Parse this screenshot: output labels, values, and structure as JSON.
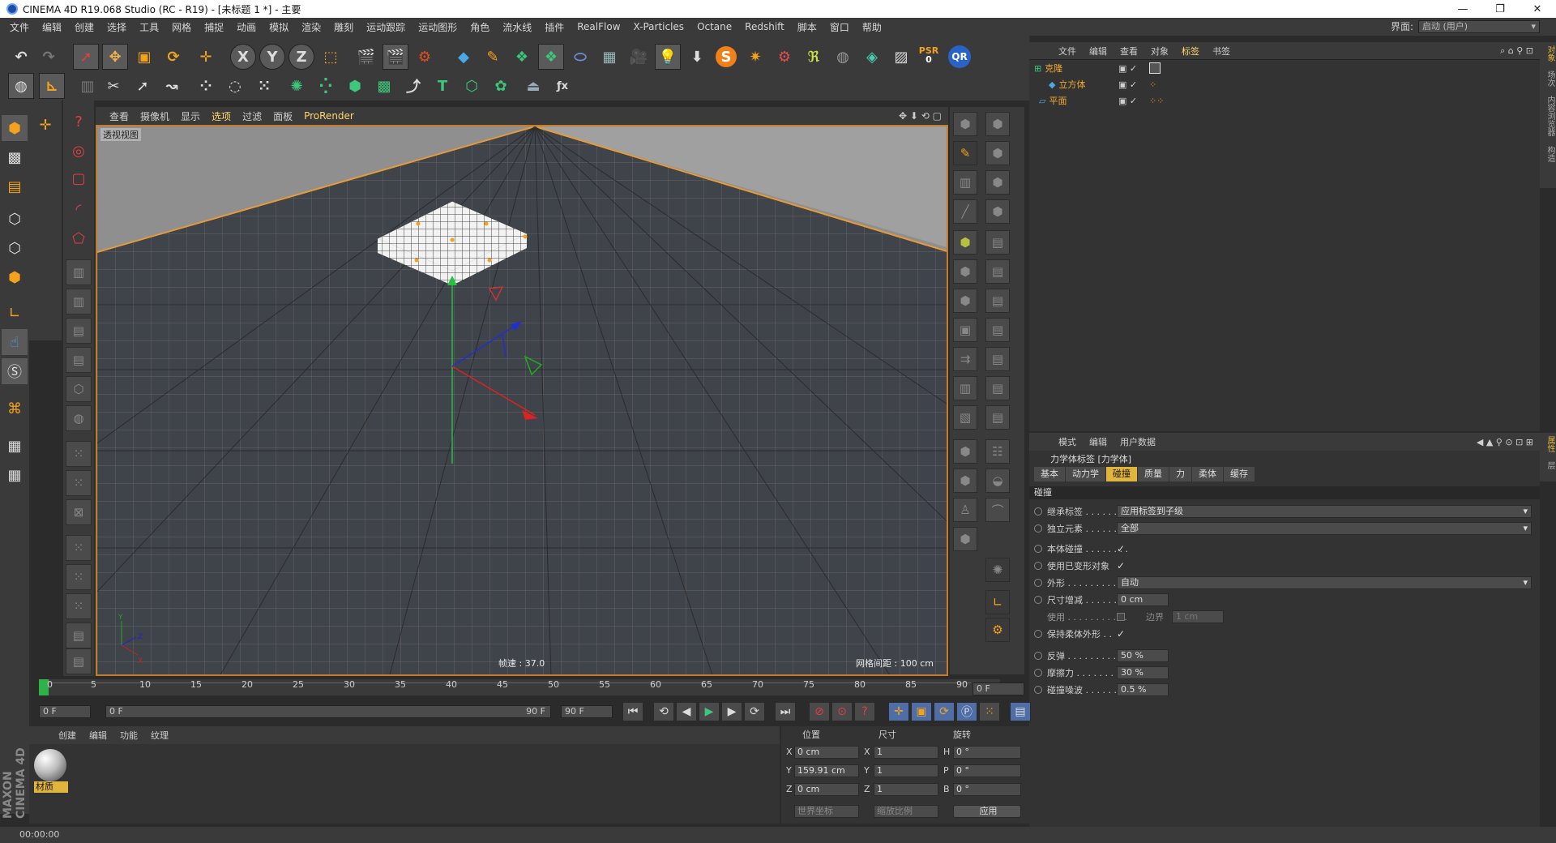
{
  "window": {
    "title": "CINEMA 4D R19.068 Studio (RC - R19) - [未标题 1 *] - 主要",
    "min": "—",
    "max": "❐",
    "close": "✕"
  },
  "menu": [
    "文件",
    "编辑",
    "创建",
    "选择",
    "工具",
    "网格",
    "捕捉",
    "动画",
    "模拟",
    "渲染",
    "雕刻",
    "运动跟踪",
    "运动图形",
    "角色",
    "流水线",
    "插件",
    "RealFlow",
    "X-Particles",
    "Octane",
    "Redshift",
    "脚本",
    "窗口",
    "帮助"
  ],
  "layout": {
    "label": "界面:",
    "value": "启动 (用户)"
  },
  "toolbar": {
    "x": "X",
    "y": "Y",
    "z": "Z",
    "psr": "PSR",
    "psr_val": "0",
    "qr": "QR"
  },
  "viewport": {
    "menu": [
      "查看",
      "摄像机",
      "显示",
      "选项",
      "过滤",
      "面板",
      "ProRender"
    ],
    "active_menu": "选项",
    "view_label": "透视视图",
    "fps": "帧速 : 37.0",
    "grid": "网格间距 : 100 cm",
    "axis_x": "X",
    "axis_y": "Y",
    "axis_z": "Z"
  },
  "objects": {
    "menu": [
      "文件",
      "编辑",
      "查看",
      "对象",
      "标签",
      "书签"
    ],
    "active_menu": "标签",
    "rows": [
      {
        "name": "克隆",
        "level": 0
      },
      {
        "name": "立方体",
        "level": 1
      },
      {
        "name": "平面",
        "level": 0
      }
    ]
  },
  "attributes": {
    "menu": [
      "模式",
      "编辑",
      "用户数据"
    ],
    "title": "力学体标签 [力学体]",
    "tabs": [
      "基本",
      "动力学",
      "碰撞",
      "质量",
      "力",
      "柔体",
      "缓存"
    ],
    "active_tab": "碰撞",
    "section": "碰撞",
    "inherit_label": "继承标签 . . . . . . . .",
    "inherit_value": "应用标签到子级",
    "individual_label": "独立元素 . . . . . . . .",
    "individual_value": "全部",
    "self_label": "本体碰撞 . . . . . . . .",
    "self_check": "✓",
    "deformed_label": "使用已变形对象",
    "deformed_check": "✓",
    "shape_label": "外形 . . . . . . . . . . . .",
    "shape_value": "自动",
    "size_label": "尺寸增减 . . . . . . . .",
    "size_value": "0 cm",
    "use_label": "使用 . . . . . . . . . . . .",
    "border_label": "边界",
    "border_value": "1 cm",
    "keep_label": "保持柔体外形 . .",
    "keep_check": "✓",
    "bounce_label": "反弹 . . . . . . . . . . . .",
    "bounce_value": "50 %",
    "friction_label": "摩擦力 . . . . . . . . . .",
    "friction_value": "30 %",
    "noise_label": "碰撞噪波 . . . . . . . .",
    "noise_value": "0.5 %"
  },
  "timeline": {
    "ticks": [
      "0",
      "5",
      "10",
      "15",
      "20",
      "25",
      "30",
      "35",
      "40",
      "45",
      "50",
      "55",
      "60",
      "65",
      "70",
      "75",
      "80",
      "85",
      "90"
    ],
    "end": "0 F",
    "start_field": "0 F",
    "range_start": "0 F",
    "range_end": "90 F",
    "max_field": "90 F"
  },
  "materials": {
    "menu": [
      "创建",
      "编辑",
      "功能",
      "纹理"
    ],
    "item": "材质"
  },
  "coords": {
    "h_pos": "位置",
    "h_size": "尺寸",
    "h_rot": "旋转",
    "rows": [
      {
        "axis": "X",
        "pos": "0 cm",
        "saxis": "X",
        "size": "1",
        "raxis": "H",
        "rot": "0 °"
      },
      {
        "axis": "Y",
        "pos": "159.91 cm",
        "saxis": "Y",
        "size": "1",
        "raxis": "P",
        "rot": "0 °"
      },
      {
        "axis": "Z",
        "pos": "0 cm",
        "saxis": "Z",
        "size": "1",
        "raxis": "B",
        "rot": "0 °"
      }
    ],
    "world": "世界坐标",
    "scale": "缩放比例",
    "apply": "应用"
  },
  "status": {
    "time": "00:00:00"
  },
  "brand": "MAXON CINEMA 4D",
  "side_tabs": {
    "top": [
      "对象",
      "场次",
      "内容浏览器",
      "构造"
    ],
    "bottom": [
      "属性",
      "层"
    ]
  }
}
